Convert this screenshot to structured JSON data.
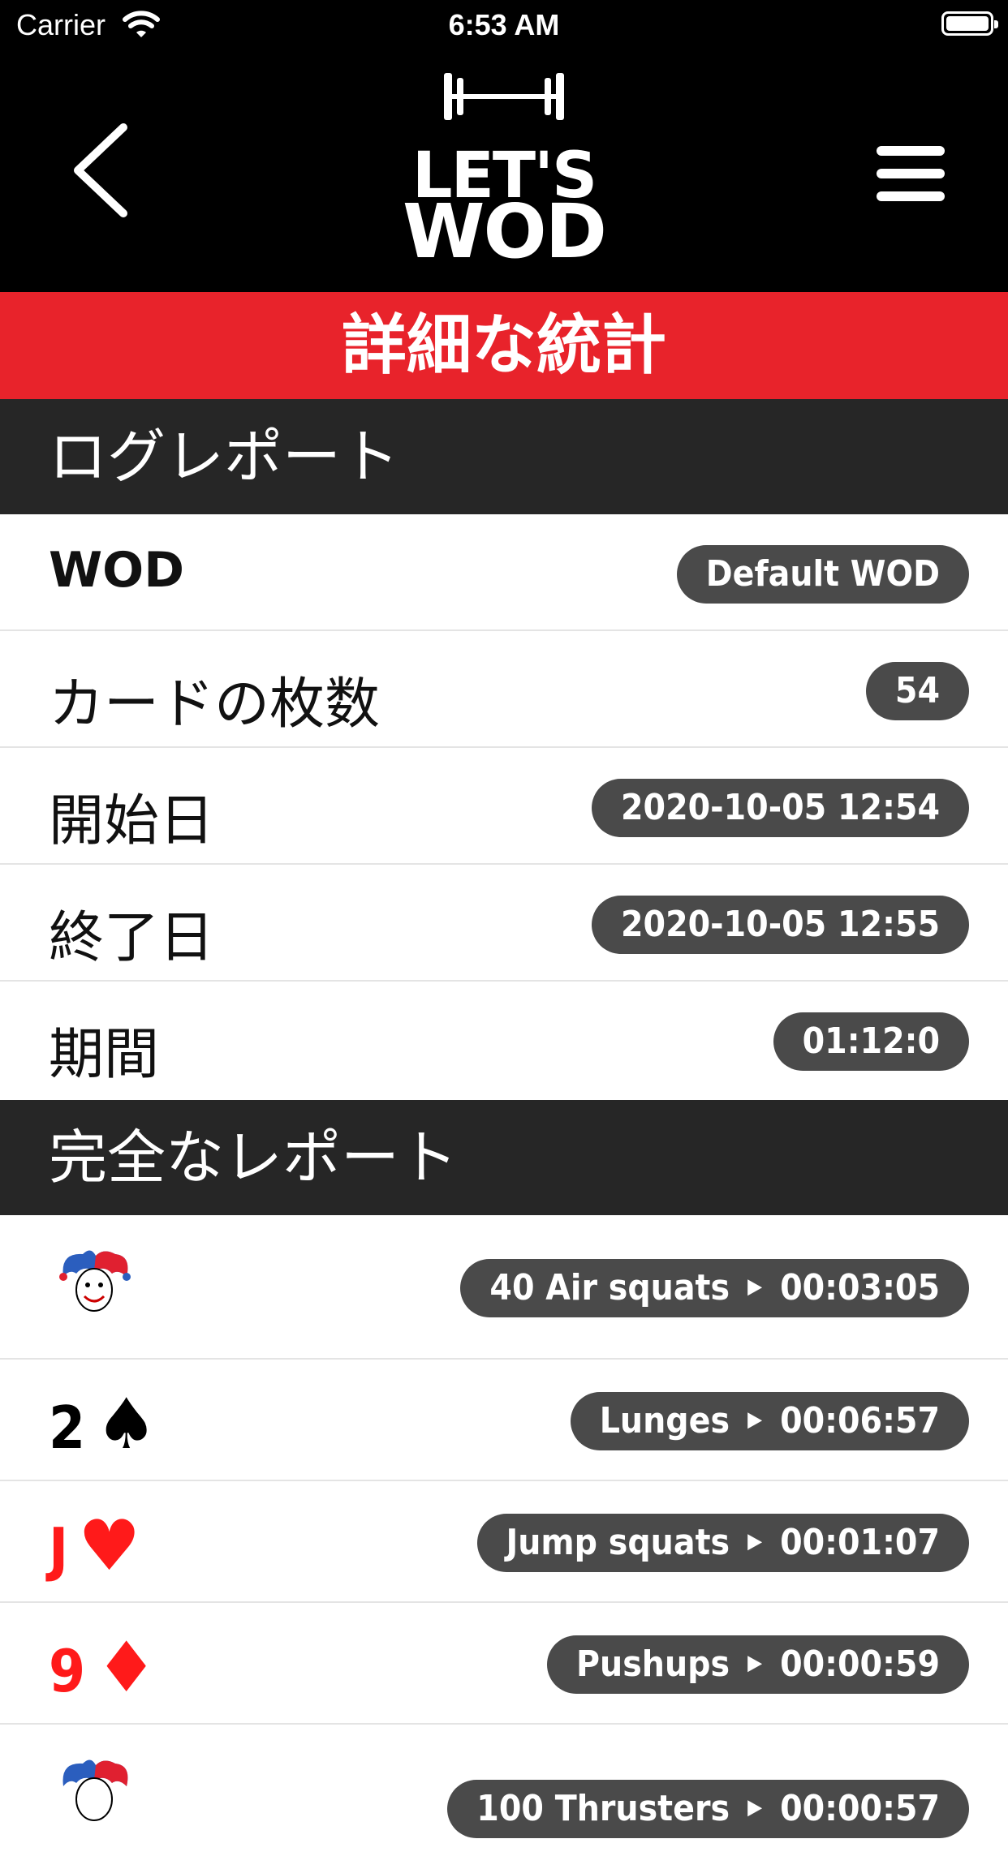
{
  "status": {
    "carrier": "Carrier",
    "time": "6:53 AM"
  },
  "header": {
    "logo_line1": "LET'S",
    "logo_line2": "WOD"
  },
  "title": "詳細な統計",
  "log_report": {
    "heading": "ログレポート",
    "rows": [
      {
        "label": "WOD",
        "value": "Default WOD"
      },
      {
        "label": "カードの枚数",
        "value": "54"
      },
      {
        "label": "開始日",
        "value": "2020-10-05 12:54"
      },
      {
        "label": "終了日",
        "value": "2020-10-05 12:55"
      },
      {
        "label": "期間",
        "value": "01:12:0"
      }
    ]
  },
  "full_report": {
    "heading": "完全なレポート",
    "rows": [
      {
        "card": "joker",
        "rank": "",
        "suit": "",
        "color": "",
        "exercise": "40 Air squats",
        "time": "00:03:05"
      },
      {
        "card": "2-spades",
        "rank": "2",
        "suit": "♠",
        "color": "#000000",
        "exercise": "Lunges",
        "time": "00:06:57"
      },
      {
        "card": "J-hearts",
        "rank": "J",
        "suit": "♥",
        "color": "#ff1a1a",
        "exercise": "Jump squats",
        "time": "00:01:07"
      },
      {
        "card": "9-diamonds",
        "rank": "9",
        "suit": "♦",
        "color": "#ff1a1a",
        "exercise": "Pushups",
        "time": "00:00:59"
      },
      {
        "card": "joker",
        "rank": "",
        "suit": "",
        "color": "",
        "exercise": "100 Thrusters",
        "time": "00:00:57"
      }
    ]
  },
  "colors": {
    "accent": "#e8232b",
    "section_bg": "#262626",
    "pill_bg": "#4a4a4a"
  }
}
